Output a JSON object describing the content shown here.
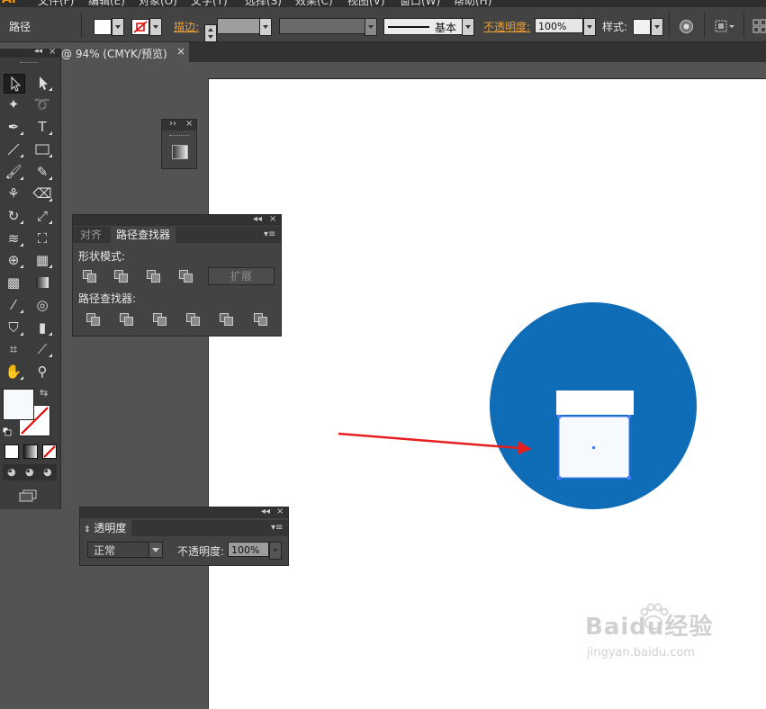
{
  "menubar": {
    "logo": "Ai",
    "items": [
      "文件(F)",
      "编辑(E)",
      "对象(O)",
      "文字(T)",
      "选择(S)",
      "效果(C)",
      "视图(V)",
      "窗口(W)",
      "帮助(H)"
    ]
  },
  "controlbar": {
    "selection_label": "路径",
    "stroke_label": "描边:",
    "stroke_style": "基本",
    "opacity_label": "不透明度:",
    "opacity_value": "100%",
    "style_label": "样式:"
  },
  "document_tab": {
    "title": "@ 94% (CMYK/预览)",
    "close": "×"
  },
  "small_panel": {
    "expand": "››",
    "close": "×"
  },
  "pathfinder_panel": {
    "collapse": "◂◂",
    "close": "×",
    "tabs": [
      "对齐",
      "路径查找器"
    ],
    "active_tab": "路径查找器",
    "shape_modes_label": "形状模式:",
    "expand_button": "扩展",
    "pathfinders_label": "路径查找器:"
  },
  "transparency_panel": {
    "collapse": "◂◂",
    "close": "×",
    "tab": "透明度",
    "blend_mode": "正常",
    "opacity_label": "不透明度:",
    "opacity_value": "100%"
  },
  "colors": {
    "circle_fill": "#0f6cb6",
    "arrow": "#e61e1e",
    "selection": "#4a7cff",
    "accent_orange": "#f0a030"
  },
  "watermark": {
    "brand": "Baidu经验",
    "url": "jingyan.baidu.com"
  }
}
